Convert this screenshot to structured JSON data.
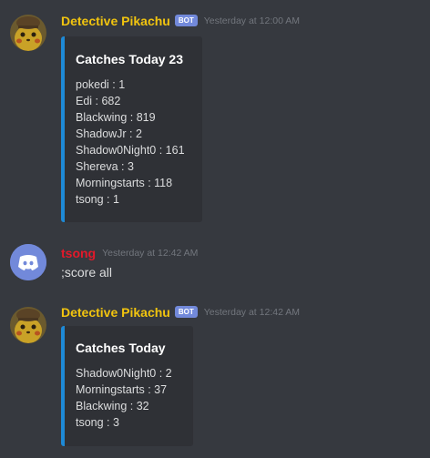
{
  "colors": {
    "background": "#36393f",
    "embed_background": "#2f3136",
    "embed_accent": "#1e8ad6",
    "bot_name": "#f1c40f",
    "user_name": "#e3192a",
    "bot_tag": "#7289da",
    "timestamp": "#72767d",
    "text": "#dcddde"
  },
  "messages": [
    {
      "author": "Detective Pikachu",
      "bot_tag": "BOT",
      "timestamp": "Yesterday at 12:00 AM",
      "avatar_icon": "pikachu-avatar-icon",
      "embed": {
        "title": "Catches Today 23",
        "lines": [
          "pokedi : 1",
          "Edi : 682",
          "Blackwing : 819",
          "ShadowJr : 2",
          "Shadow0Night0 : 161",
          "Shereva : 3",
          "Morningstarts : 118",
          "tsong : 1"
        ]
      }
    },
    {
      "author": "tsong",
      "timestamp": "Yesterday at 12:42 AM",
      "avatar_icon": "discord-logo-icon",
      "text": ";score all"
    },
    {
      "author": "Detective Pikachu",
      "bot_tag": "BOT",
      "timestamp": "Yesterday at 12:42 AM",
      "avatar_icon": "pikachu-avatar-icon",
      "embed": {
        "title": "Catches Today",
        "lines": [
          "Shadow0Night0 : 2",
          "Morningstarts : 37",
          "Blackwing : 32",
          "tsong : 3"
        ]
      }
    }
  ]
}
